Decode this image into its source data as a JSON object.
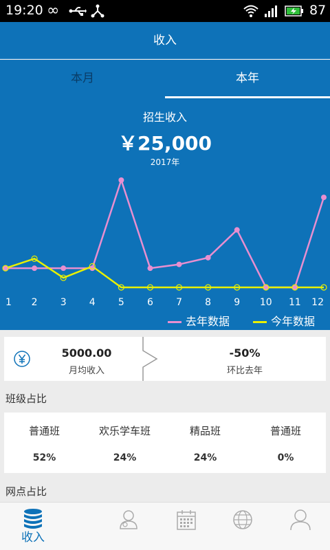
{
  "status_bar": {
    "time": "19:20",
    "battery_level": "87"
  },
  "header": {
    "title": "收入"
  },
  "tabs": [
    {
      "label": "本月",
      "active": false
    },
    {
      "label": "本年",
      "active": true
    }
  ],
  "chart": {
    "title": "招生收入",
    "total": "￥25,000",
    "year": "2017年"
  },
  "chart_data": {
    "type": "line",
    "x": [
      1,
      2,
      3,
      4,
      5,
      6,
      7,
      8,
      9,
      10,
      11,
      12
    ],
    "series": [
      {
        "name": "去年数据",
        "color": "#e88fd0",
        "values": [
          1000,
          1000,
          1000,
          1000,
          5600,
          1000,
          1200,
          1550,
          3000,
          0,
          0,
          4700
        ]
      },
      {
        "name": "今年数据",
        "color": "#e8f000",
        "values": [
          1000,
          1500,
          500,
          1100,
          0,
          0,
          0,
          0,
          0,
          0,
          0,
          0
        ]
      }
    ],
    "xlim": [
      1,
      12
    ],
    "ylim": [
      0,
      5600
    ],
    "grid": false,
    "legend": "bottom-right"
  },
  "summary": {
    "monthly_value": "5000.00",
    "monthly_label": "月均收入",
    "yoy_value": "-50%",
    "yoy_label": "环比去年"
  },
  "class_share": {
    "title": "班级占比",
    "items": [
      {
        "name": "普通班",
        "pct": "52%"
      },
      {
        "name": "欢乐学车班",
        "pct": "24%"
      },
      {
        "name": "精品班",
        "pct": "24%"
      },
      {
        "name": "普通班",
        "pct": "0%"
      }
    ]
  },
  "branch_share": {
    "title": "网点占比"
  },
  "bottom_nav": [
    {
      "icon": "database-icon",
      "label": "收入",
      "active": true
    },
    {
      "icon": "users-icon",
      "label": "",
      "active": false
    },
    {
      "icon": "calendar-icon",
      "label": "",
      "active": false
    },
    {
      "icon": "globe-icon",
      "label": "",
      "active": false
    },
    {
      "icon": "person-icon",
      "label": "",
      "active": false
    }
  ],
  "colors": {
    "primary": "#0e72b8",
    "last_year_line": "#e88fd0",
    "this_year_line": "#e8f000"
  }
}
